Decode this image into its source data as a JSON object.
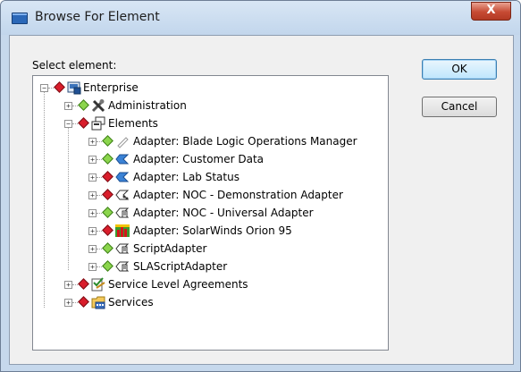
{
  "window": {
    "title": "Browse For Element",
    "close_label": "X"
  },
  "dialog": {
    "select_label": "Select element:",
    "ok_label": "OK",
    "cancel_label": "Cancel"
  },
  "tree": {
    "root": {
      "label": "Enterprise",
      "status": "red",
      "expander": "−"
    },
    "administration": {
      "label": "Administration",
      "status": "green",
      "expander": "+"
    },
    "elements": {
      "label": "Elements",
      "status": "red",
      "expander": "−"
    },
    "children": [
      {
        "label": "Adapter: Blade Logic Operations Manager",
        "status": "green",
        "icon": "pencil-icon"
      },
      {
        "label": "Adapter: Customer Data",
        "status": "green",
        "icon": "adapter-arrow-icon"
      },
      {
        "label": "Adapter: Lab Status",
        "status": "red",
        "icon": "adapter-arrow-icon"
      },
      {
        "label": "Adapter: NOC - Demonstration Adapter",
        "status": "red",
        "icon": "adapter-cluster-icon"
      },
      {
        "label": "Adapter: NOC - Universal Adapter",
        "status": "green",
        "icon": "script-adapter-icon"
      },
      {
        "label": "Adapter: SolarWinds Orion 95",
        "status": "red",
        "icon": "solarwinds-icon"
      },
      {
        "label": "ScriptAdapter",
        "status": "green",
        "icon": "script-adapter-icon"
      },
      {
        "label": "SLAScriptAdapter",
        "status": "green",
        "icon": "script-adapter-icon"
      }
    ],
    "sla": {
      "label": "Service Level Agreements",
      "status": "red",
      "expander": "+"
    },
    "services": {
      "label": "Services",
      "status": "red",
      "expander": "+"
    }
  }
}
